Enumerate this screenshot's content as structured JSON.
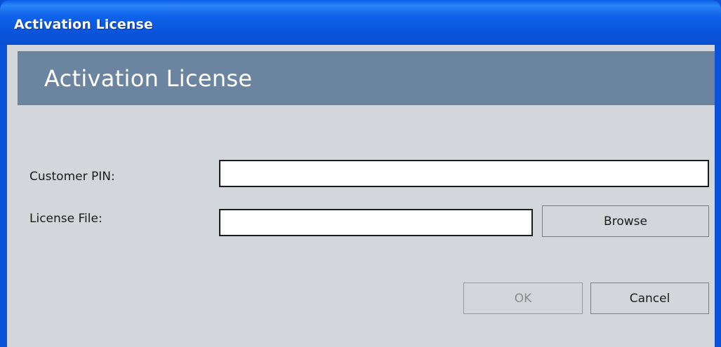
{
  "window": {
    "title": "Activation License"
  },
  "header": {
    "title": "Activation License"
  },
  "form": {
    "customer_pin_label": "Customer PIN:",
    "customer_pin_value": "",
    "license_file_label": "License File:",
    "license_file_value": "",
    "browse_label": "Browse"
  },
  "actions": {
    "ok_label": "OK",
    "ok_enabled": false,
    "cancel_label": "Cancel"
  },
  "colors": {
    "titlebar": "#0a55dc",
    "header_band": "#6b849f",
    "client_bg": "#d3d7db"
  }
}
